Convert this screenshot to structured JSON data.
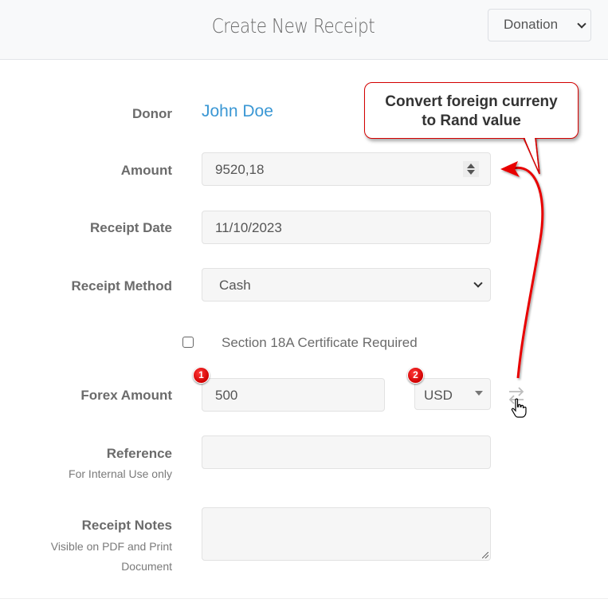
{
  "header": {
    "title": "Create New Receipt",
    "type_select": {
      "value": "Donation"
    }
  },
  "form": {
    "donor": {
      "label": "Donor",
      "value": "John Doe",
      "link_color": "#3a97d4"
    },
    "amount": {
      "label": "Amount",
      "value": "9520,18"
    },
    "receipt_date": {
      "label": "Receipt Date",
      "value": "11/10/2023"
    },
    "receipt_method": {
      "label": "Receipt Method",
      "value": "Cash"
    },
    "section18a": {
      "label": "Section 18A Certificate Required",
      "checked": false
    },
    "forex": {
      "label": "Forex Amount",
      "value": "500",
      "currency": "USD"
    },
    "reference": {
      "label": "Reference",
      "sublabel": "For Internal Use only",
      "value": ""
    },
    "notes": {
      "label": "Receipt Notes",
      "sublabel_line1": "Visible on PDF and Print",
      "sublabel_line2": "Document",
      "value": ""
    }
  },
  "annotations": {
    "callout_line1": "Convert foreign curreny",
    "callout_line2": "to Rand value",
    "badge1": "1",
    "badge2": "2",
    "accent_color": "#e00000"
  },
  "icons": {
    "convert": "exchange-arrows-icon",
    "cursor": "hand-pointer-icon"
  }
}
